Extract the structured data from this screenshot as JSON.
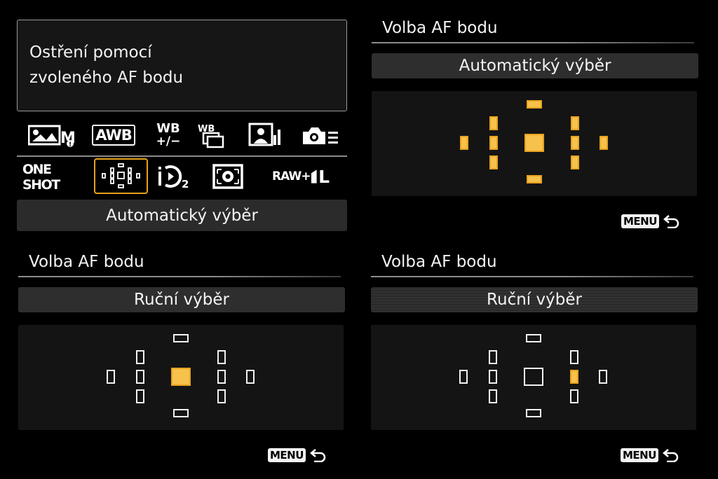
{
  "quick_control": {
    "info_line1": "Ostření pomocí",
    "info_line2": "zvoleného AF bodu",
    "row1_icons": [
      "picture-style-icon",
      "awb-icon",
      "wb-shift-icon",
      "wb-bracketing-icon",
      "portrait-style-icon",
      "camera-settings-icon"
    ],
    "awb_label": "AWB",
    "wb_label": "WB",
    "wb_shift_label": "+/−",
    "af_mode_label": "ONE SHOT",
    "raw_label": "RAW+",
    "quality_label": "L",
    "drive_sub": "2",
    "selected_mode": "Automatický výběr",
    "colors": {
      "accent": "#e8a21e",
      "active_point": "#f6c24c"
    }
  },
  "panels": [
    {
      "title": "Volba AF bodu",
      "mode": "Automatický výběr",
      "active_points": [
        "top",
        "upper-left",
        "upper-right",
        "far-left",
        "mid-left",
        "center",
        "mid-right",
        "far-right",
        "lower-left",
        "lower-right",
        "bottom"
      ],
      "menu_label": "MENU"
    },
    {
      "title": "Volba AF bodu",
      "mode": "Ruční výběr",
      "active_points": [
        "center"
      ],
      "menu_label": "MENU"
    },
    {
      "title": "Volba AF bodu",
      "mode": "Ruční výběr",
      "active_points": [
        "mid-right"
      ],
      "menu_label": "MENU"
    }
  ]
}
